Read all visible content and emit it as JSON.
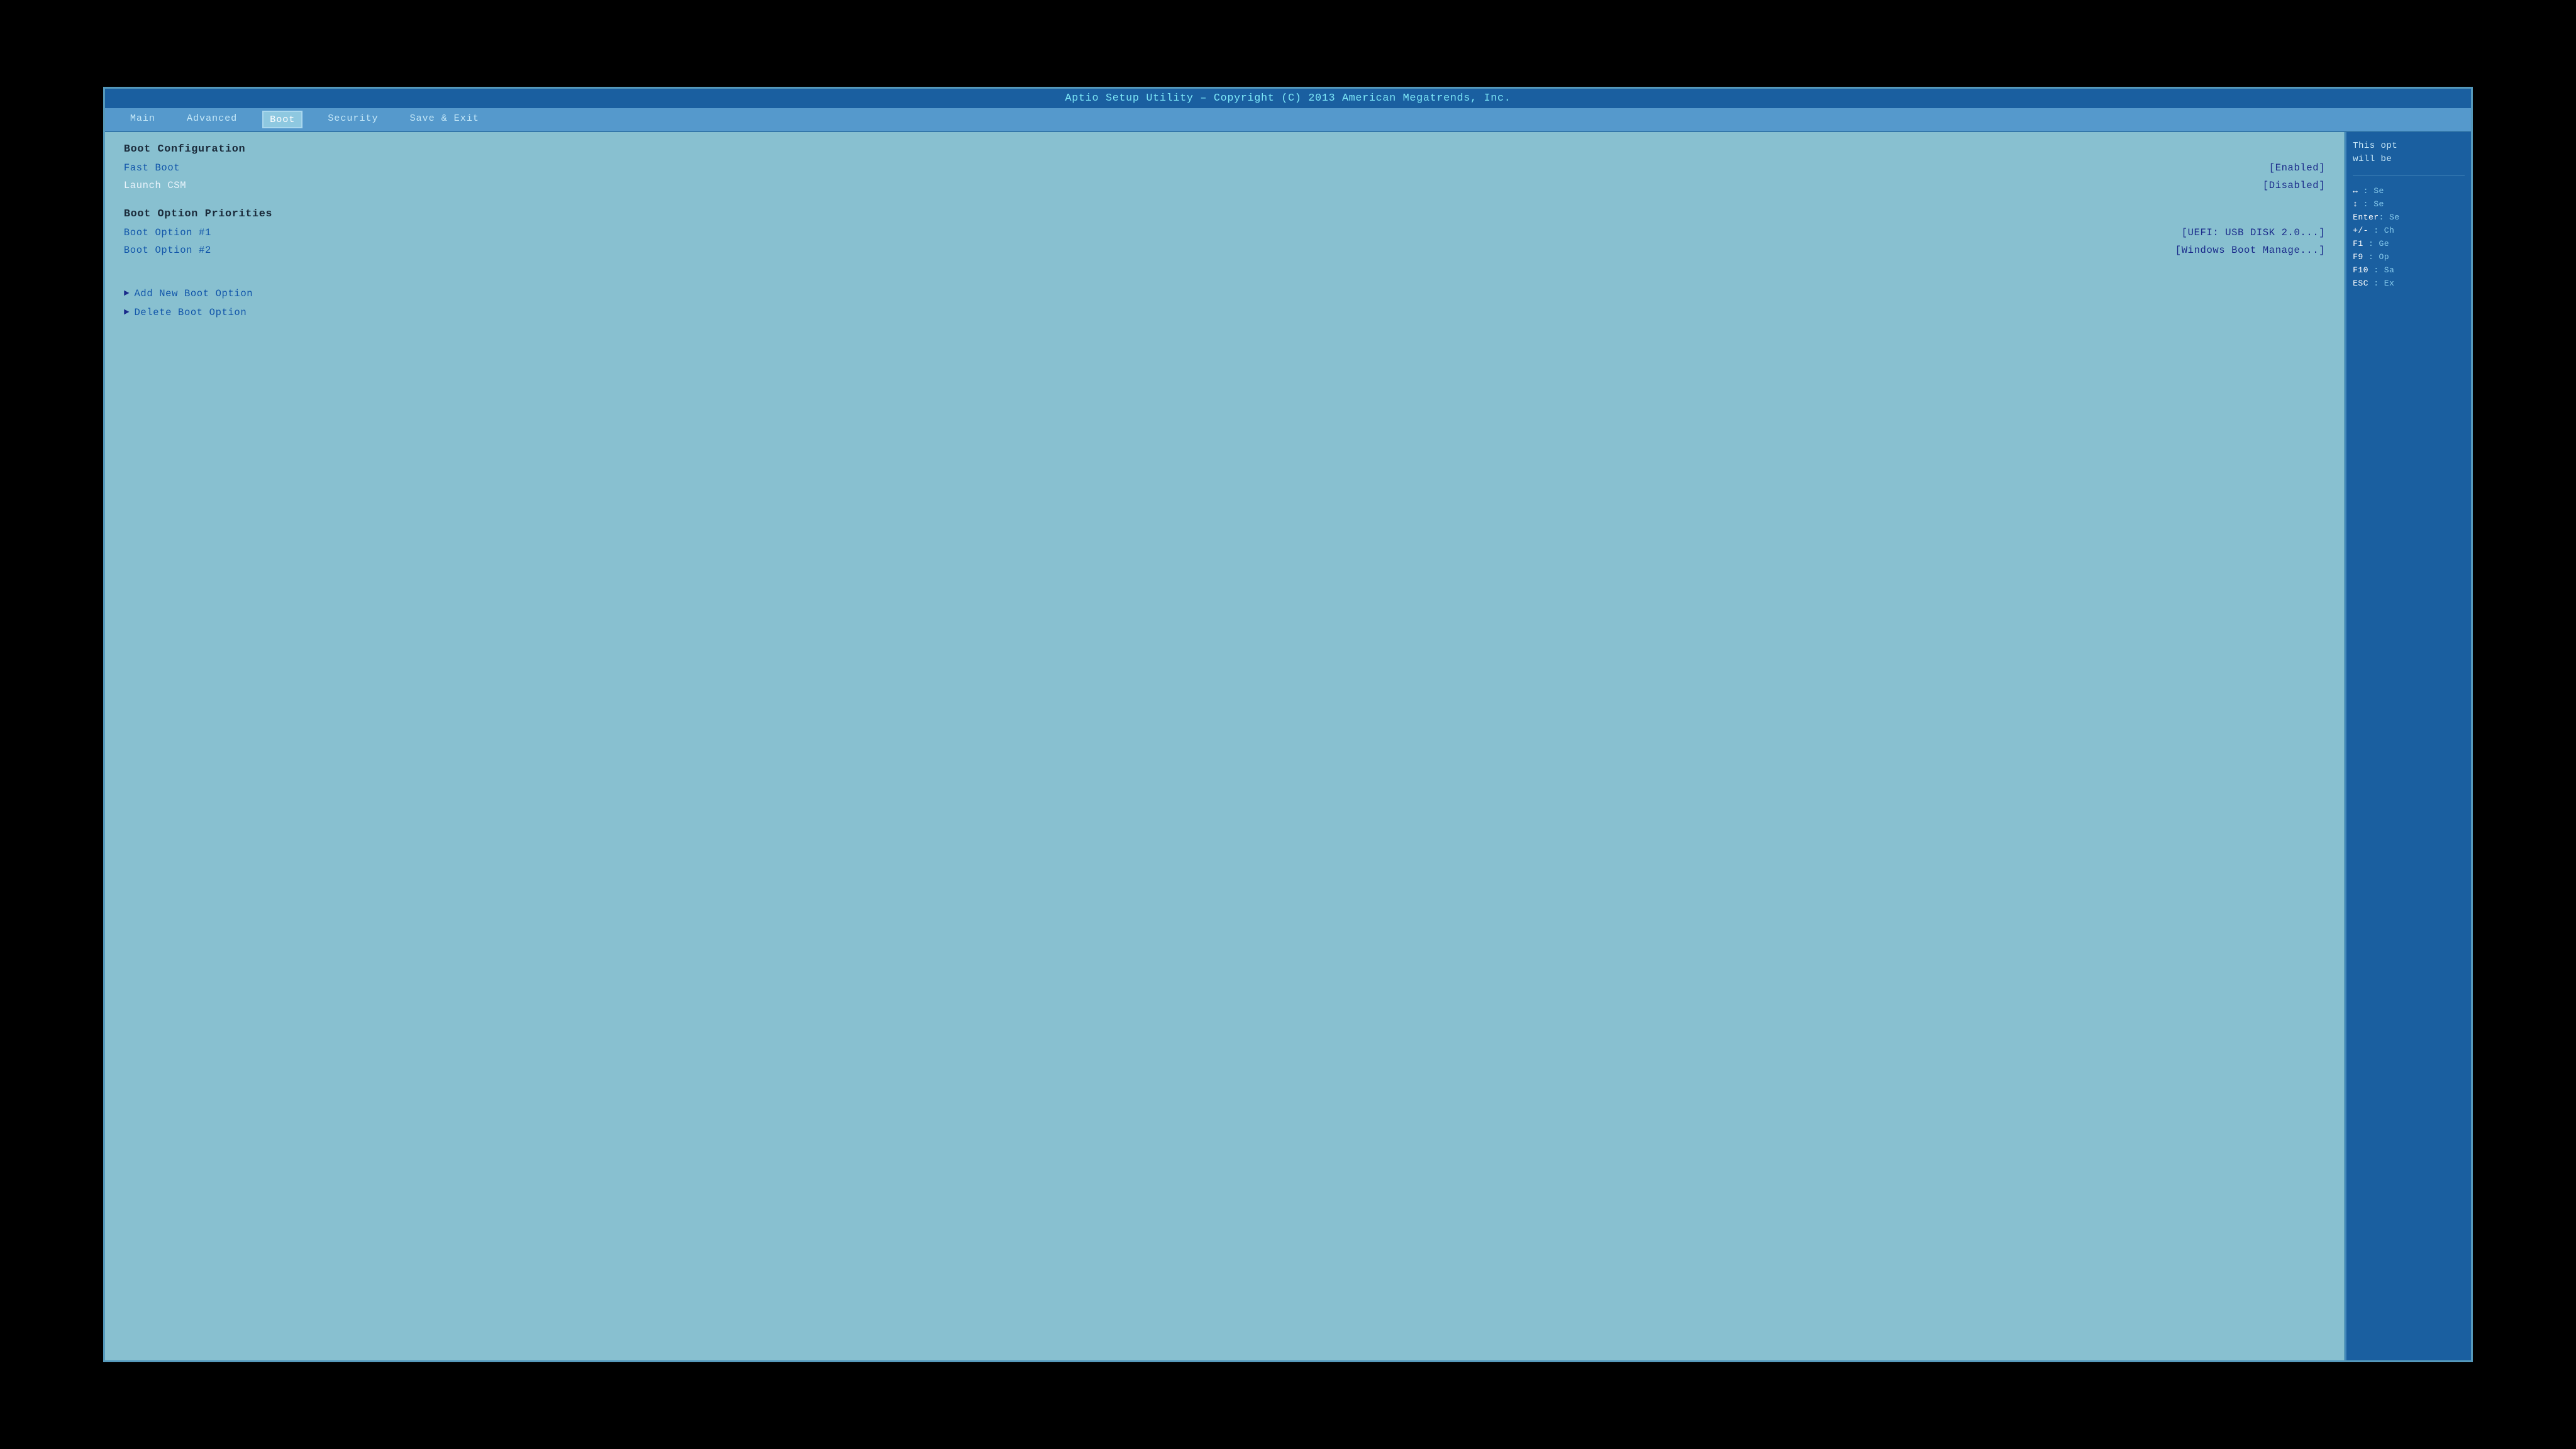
{
  "title_bar": {
    "text": "Aptio Setup Utility – Copyright (C) 2013 American Megatrends, Inc."
  },
  "nav": {
    "tabs": [
      {
        "label": "Main",
        "active": false
      },
      {
        "label": "Advanced",
        "active": false
      },
      {
        "label": "Boot",
        "active": true
      },
      {
        "label": "Security",
        "active": false
      },
      {
        "label": "Save & Exit",
        "active": false
      }
    ]
  },
  "boot_config": {
    "section_title": "Boot Configuration",
    "items": [
      {
        "label": "Fast Boot",
        "value": "[Enabled]",
        "label_style": "blue"
      },
      {
        "label": "Launch CSM",
        "value": "[Disabled]",
        "label_style": "white"
      }
    ]
  },
  "boot_priorities": {
    "section_title": "Boot Option Priorities",
    "items": [
      {
        "label": "Boot Option #1",
        "value": "[UEFI:  USB DISK 2.0...]",
        "label_style": "blue"
      },
      {
        "label": "Boot Option #2",
        "value": "[Windows Boot Manage...]",
        "label_style": "blue"
      }
    ]
  },
  "submenu_items": [
    {
      "label": "Add New Boot Option"
    },
    {
      "label": "Delete Boot Option"
    }
  ],
  "help_panel": {
    "description_line1": "This opt",
    "description_line2": "will be",
    "shortcuts": [
      {
        "key": "↔",
        "desc": ": Se"
      },
      {
        "key": "↕",
        "desc": ": Se"
      },
      {
        "key": "Enter",
        "desc": ": Se"
      },
      {
        "key": "+/-",
        "desc": ": Ch"
      },
      {
        "key": "F1",
        "desc": ": Ge"
      },
      {
        "key": "F9",
        "desc": ": Op"
      },
      {
        "key": "F10",
        "desc": ": Sa"
      },
      {
        "key": "ESC",
        "desc": ": Ex"
      }
    ]
  }
}
